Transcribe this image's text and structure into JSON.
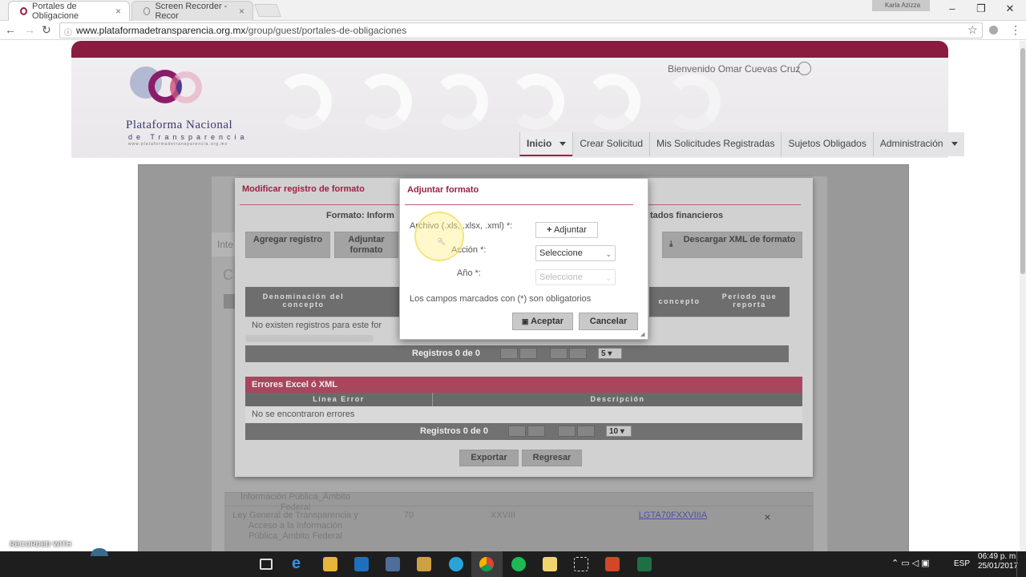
{
  "browser": {
    "tabs": [
      {
        "title": "Portales de Obligacione"
      },
      {
        "title": "Screen Recorder - Recor"
      }
    ],
    "url_host": "www.plataformadetransparencia.org.mx",
    "url_path": "/group/guest/portales-de-obligaciones",
    "profile": "Karla Azizza"
  },
  "header": {
    "logo_title": "Plataforma Nacional",
    "logo_subtitle": "de Transparencia",
    "logo_url": "www.plataformadetransparencia.org.mx",
    "welcome": "Bienvenido Omar Cuevas Cruz",
    "nav": [
      "Inicio",
      "Crear Solicitud",
      "Mis Solicitudes Registradas",
      "Sujetos Obligados",
      "Administración"
    ]
  },
  "background": {
    "left_tab": "Inte",
    "left_letter": "C",
    "rows": [
      {
        "name": "Información Pública_Ámbito Federal"
      },
      {
        "name": "Ley General de Transparencia y Acceso a la Información Pública_Ámbito Federal",
        "num": "70",
        "fraction": "XXVIII",
        "link": "LGTA70FXXVIIIA",
        "action": "×"
      }
    ]
  },
  "modify_dialog": {
    "title": "Modificar registro de formato",
    "formato_left": "Formato: Inform",
    "formato_right": "tados financieros",
    "buttons": [
      "Agregar registro",
      "Adjuntar formato",
      "Descargar XML de formato"
    ],
    "table_headers": [
      "Denominación del concepto",
      "concepto",
      "Periodo que reporta"
    ],
    "empty_text": "No existen registros para este for",
    "pager_text": "Registros 0 de 0",
    "page_size": "5",
    "errors_title": "Errores Excel ó XML",
    "errors_headers": [
      "Línea Error",
      "Descripción"
    ],
    "errors_empty": "No se encontraron errores",
    "errors_pager_text": "Registros 0 de 0",
    "errors_page_size": "10",
    "export_label": "Exportar",
    "back_label": "Regresar"
  },
  "attach_dialog": {
    "title": "Adjuntar formato",
    "file_label": "Archivo (.xls, .xlsx, .xml) *:",
    "attach_button": "Adjuntar",
    "action_label": "Acción *:",
    "action_value": "Seleccione",
    "year_label": "Año *:",
    "year_value": "Seleccione",
    "required_note": "Los campos marcados con (*) son obligatorios",
    "accept_label": "Aceptar",
    "cancel_label": "Cancelar"
  },
  "taskbar": {
    "language": "ESP",
    "time": "06:49 p. m.",
    "date": "25/01/2017"
  },
  "watermark": "RECORDED WITH",
  "colors": {
    "brand": "#8a1c3f",
    "accent": "#9b2042",
    "nav_active": "#b0173f"
  }
}
